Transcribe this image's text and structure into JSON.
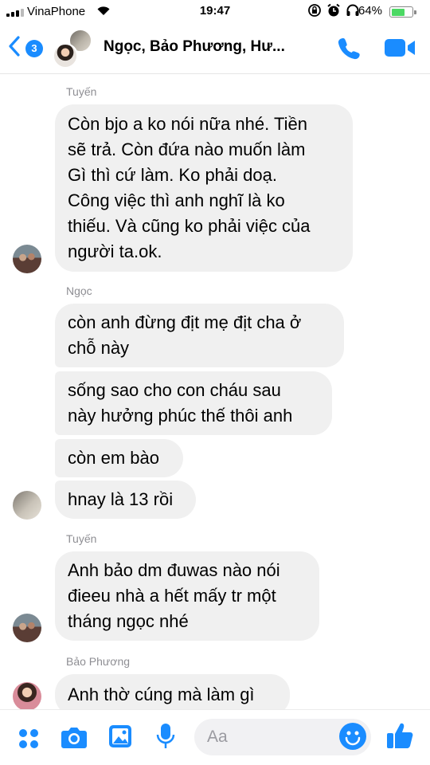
{
  "status_bar": {
    "carrier": "VinaPhone",
    "time": "19:47",
    "battery": "64%",
    "battery_level": 0.64
  },
  "header": {
    "back_count": "3",
    "title": "Ngọc, Bảo Phương, Hư..."
  },
  "messages": {
    "m1": {
      "sender": "Tuyến",
      "lines": [
        "Còn bjo a ko nói nữa nhé. Tiền",
        "sẽ trả. Còn đứa nào muốn làm",
        "Gì thì cứ làm. Ko phải doạ.",
        "Công việc thì anh nghĩ là ko",
        "thiếu. Và cũng ko phải việc của",
        "người ta.ok."
      ]
    },
    "m2": {
      "sender": "Ngọc",
      "lines": [
        "còn anh đừng địt mẹ địt cha ở",
        "chỗ này"
      ]
    },
    "m3": {
      "lines": [
        "sống sao cho con cháu sau",
        "này hưởng phúc thế thôi anh"
      ]
    },
    "m4": {
      "lines": [
        "còn em bào"
      ]
    },
    "m5": {
      "lines": [
        "hnay là 13 rồi"
      ]
    },
    "m6": {
      "sender": "Tuyến",
      "lines": [
        "Anh bảo dm đuwas nào nói",
        "đieeu nhà a hết mấy tr một",
        "tháng ngọc nhé"
      ]
    },
    "m7": {
      "sender": "Bảo Phương",
      "lines": [
        "Anh thờ cúng mà làm gì"
      ]
    }
  },
  "input": {
    "placeholder": "Aa"
  },
  "colors": {
    "accent": "#1a8cff",
    "bubble": "#f0f0f0",
    "battery_fill": "#4cd964"
  },
  "icons": [
    "signal-bars-icon",
    "wifi-icon",
    "rotation-lock-icon",
    "alarm-icon",
    "headphones-icon",
    "battery-icon",
    "back-chevron-icon",
    "phone-icon",
    "video-camera-icon",
    "menu-dots-icon",
    "camera-icon",
    "image-icon",
    "microphone-icon",
    "emoji-icon",
    "thumbs-up-icon"
  ]
}
